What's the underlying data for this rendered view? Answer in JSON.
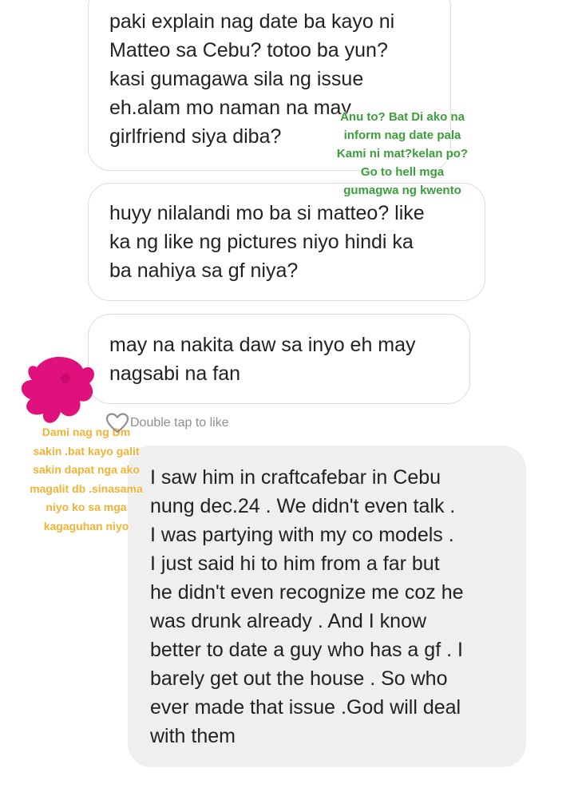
{
  "messages": [
    {
      "lines": [
        "paki explain nag date ba kayo ni",
        "Matteo sa Cebu? totoo ba yun?",
        "kasi gumagawa sila ng issue",
        "eh.alam mo naman na may",
        "girlfriend siya diba?"
      ]
    },
    {
      "lines": [
        "huyy nilalandi mo ba si matteo? like",
        "ka ng like ng pictures niyo hindi ka",
        "ba nahiya sa gf niya?"
      ]
    },
    {
      "lines": [
        "may na nakita daw sa inyo eh may",
        "nagsabi na fan"
      ]
    }
  ],
  "like_hint": {
    "icon": "heart-outline-icon",
    "label": "Double tap to like"
  },
  "reply": {
    "lines": [
      "I saw him in craftcafebar in Cebu",
      "nung dec.24 . We didn't even talk .",
      "I was partying with my co models .",
      "I just said hi to him from a far but",
      "he didn't even recognize me coz he",
      "was drunk already . And I know",
      "better to date a guy who has a gf . I",
      "barely get out the house . So who",
      "ever made that issue .God will deal",
      "with them"
    ]
  },
  "annotations": {
    "green": {
      "color": "#3b9e3b",
      "lines": [
        "Anu to? Bat Di ako na",
        "inform nag date pala",
        "Kami ni mat?kelan po?",
        "Go to hell mga",
        "gumagwa ng kwento"
      ]
    },
    "orange": {
      "color": "#f2b233",
      "lines": [
        "Dami nag ng Dm",
        "sakin .bat kayo galit",
        "sakin dapat nga ako",
        "magalit db .sinasama",
        "niyo ko sa mga",
        "kagaguhan niyo"
      ]
    },
    "scribble_color": "#e0107c"
  }
}
